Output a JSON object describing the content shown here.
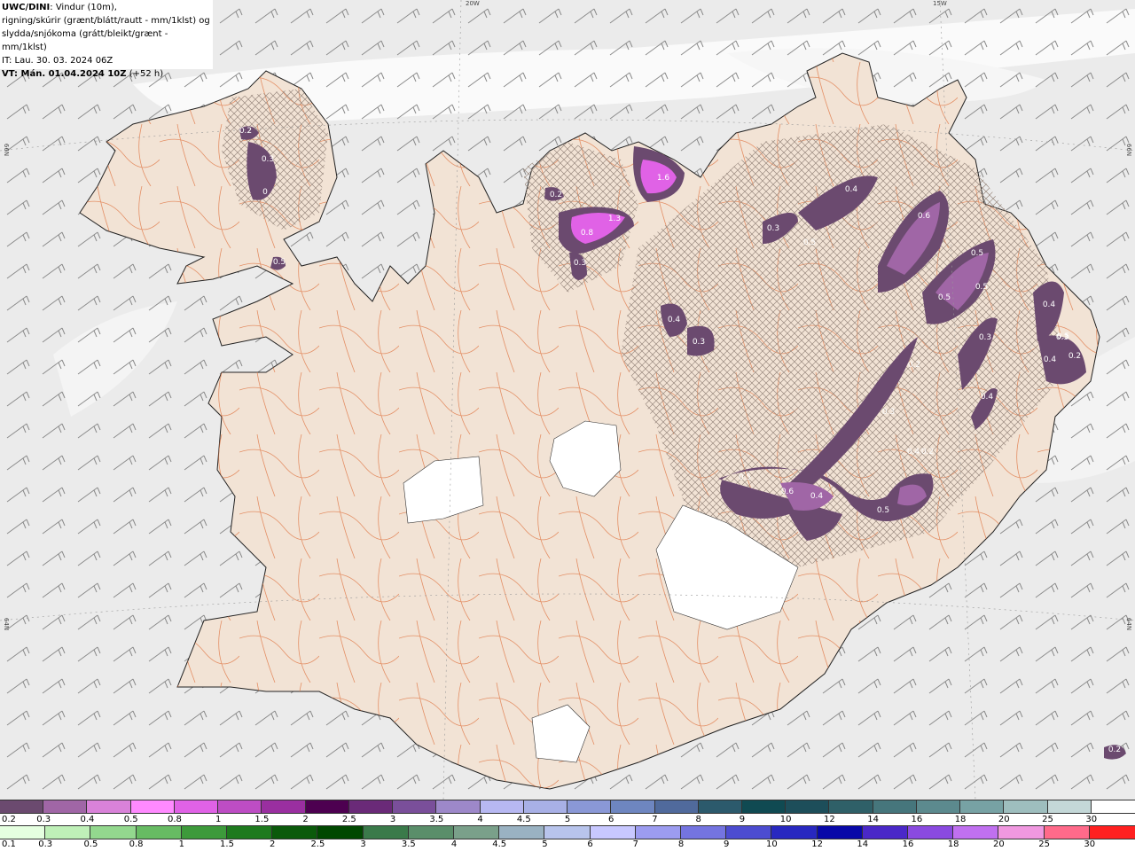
{
  "header": {
    "model": "UWC/DINI",
    "line1_rest": ": Vindur (10m),",
    "line2": "rigning/skúrir (grænt/blátt/rautt - mm/1klst) og",
    "line3": "slydda/snjókoma (grátt/bleikt/grænt - mm/1klst)",
    "init_time": "IT: Lau. 30. 03. 2024 06Z",
    "valid_prefix": "VT: Mán. 01.04.2024 10Z",
    "valid_offset": " (+52 h)"
  },
  "axis_labels": {
    "top": [
      "20W",
      "15W"
    ],
    "left": [
      "66N",
      "64N"
    ],
    "right": [
      "66N",
      "64N"
    ]
  },
  "precip_labels": [
    "0.2",
    "0.3",
    "0",
    "0.5",
    "0.2",
    "1.6",
    "1.3",
    "0.8",
    "0.3",
    "0.4",
    "0.3",
    "0.4",
    "0.3",
    "0.5",
    "0.6",
    "0.5",
    "0.5",
    "0.5",
    "0.3",
    "0.4",
    "0.5",
    "0.4",
    "0.3",
    "0.2",
    "0.3",
    "0.4",
    "0.2",
    "0.2",
    "0.4",
    "0.5",
    "0.6",
    "0.4",
    "0.5",
    "0.2"
  ],
  "legend": {
    "snow": {
      "ticks": [
        "0.2",
        "0.3",
        "0.4",
        "0.5",
        "0.8",
        "1",
        "1.5",
        "2",
        "2.5",
        "3",
        "3.5",
        "4",
        "4.5",
        "5",
        "6",
        "7",
        "8",
        "9",
        "10",
        "12",
        "14",
        "16",
        "18",
        "20",
        "25",
        "30"
      ],
      "colors": [
        "#6b4a6f",
        "#a066a6",
        "#d982d9",
        "#ff8aff",
        "#e062e6",
        "#bd4dc4",
        "#9a2fa0",
        "#4d0050",
        "#6a2a78",
        "#7a4f9a",
        "#9d88c9",
        "#b7b8f2",
        "#a8b0e6",
        "#8a98d6",
        "#6e86c0",
        "#506a9c",
        "#2c5a6c",
        "#104a52",
        "#1d4e5a",
        "#2f6068",
        "#46767c",
        "#5c8a8e",
        "#77a2a4",
        "#9ebebe",
        "#c4d8d8",
        "#ffffff"
      ]
    },
    "rain": {
      "ticks": [
        "0.1",
        "0.3",
        "0.5",
        "0.8",
        "1",
        "1.5",
        "2",
        "2.5",
        "3",
        "3.5",
        "4",
        "4.5",
        "5",
        "6",
        "7",
        "8",
        "9",
        "10",
        "12",
        "14",
        "16",
        "18",
        "20",
        "25",
        "30"
      ],
      "colors": [
        "#e5ffe0",
        "#bff0b8",
        "#93d88e",
        "#67bb63",
        "#3d9a3b",
        "#1e7a1e",
        "#0b5a0b",
        "#004800",
        "#3a7a4a",
        "#5a8e6a",
        "#7aa08a",
        "#9ab2c2",
        "#b8c4ec",
        "#c8c8ff",
        "#9c9cf0",
        "#7474e0",
        "#4c4cd0",
        "#2828c0",
        "#0808a8",
        "#4a28c8",
        "#8a4ae0",
        "#c070f0",
        "#f098e0",
        "#ff6a8a",
        "#ff2020"
      ]
    }
  }
}
